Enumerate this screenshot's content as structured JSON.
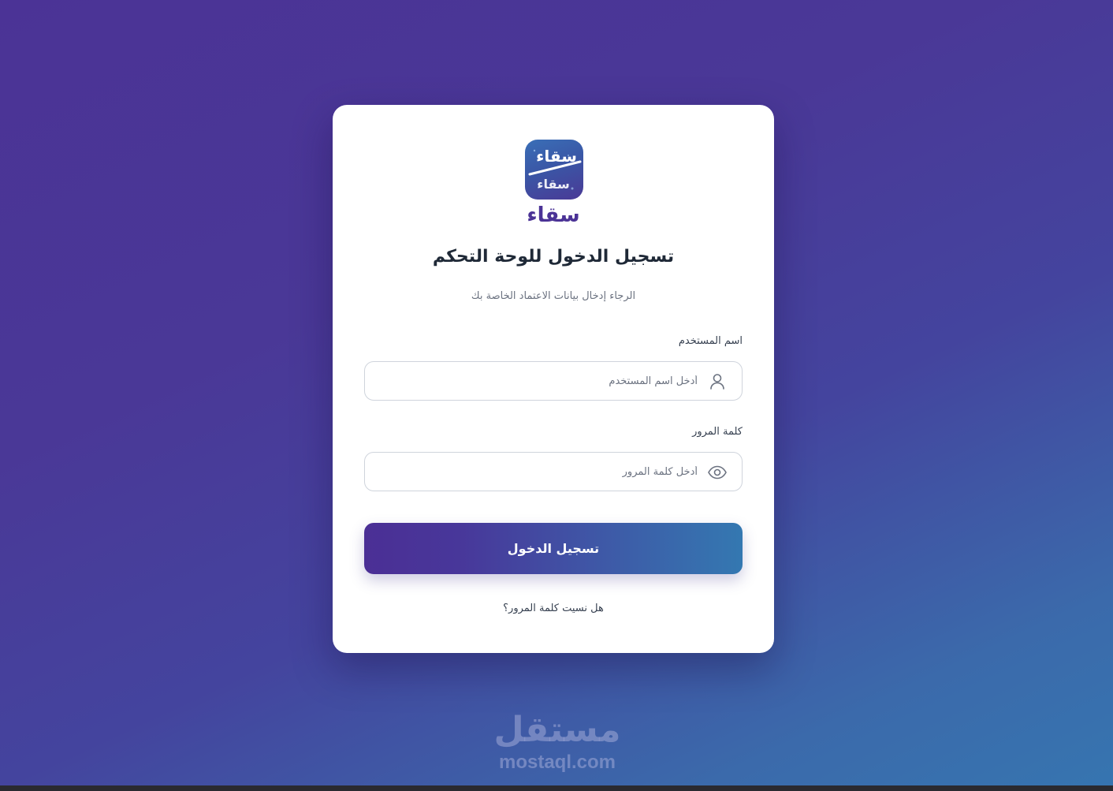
{
  "brand": {
    "logo_tile_text": "سقاء",
    "logo_wordmark": "سقاء",
    "primary_color": "#4b2f95",
    "accent_color": "#3478b1"
  },
  "login": {
    "title": "تسجيل الدخول للوحة التحكم",
    "subtitle": "الرجاء إدخال بيانات الاعتماد الخاصة بك",
    "username": {
      "label": "اسم المستخدم",
      "placeholder": "أدخل اسم المستخدم",
      "icon": "user-icon"
    },
    "password": {
      "label": "كلمة المرور",
      "placeholder": "أدخل كلمة المرور",
      "icon": "eye-icon"
    },
    "submit_label": "تسجيل الدخول",
    "forgot_label": "هل نسيت كلمة المرور؟"
  },
  "watermark": {
    "arabic": "مستقل",
    "latin": "mostaql.com"
  }
}
